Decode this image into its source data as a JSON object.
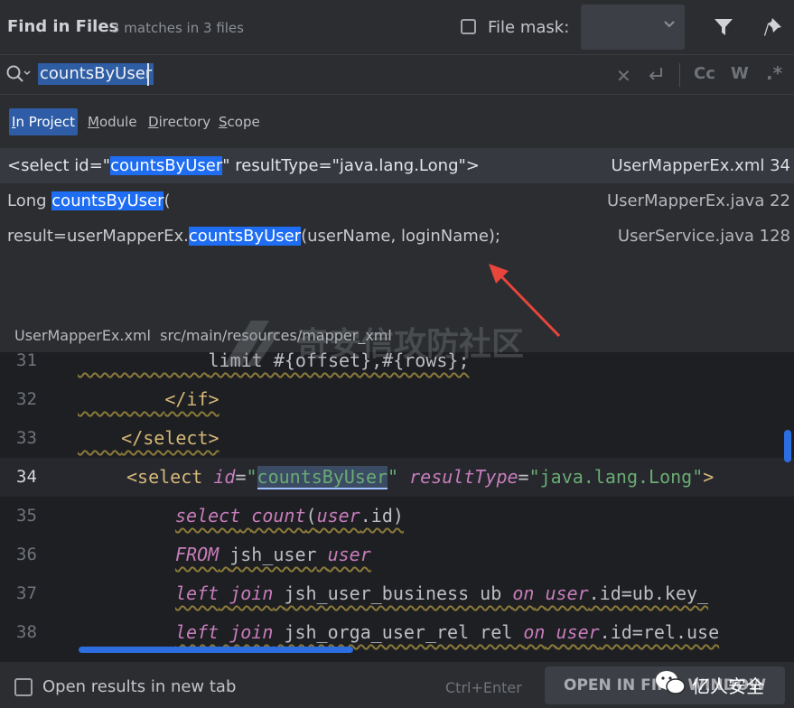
{
  "header": {
    "title": "Find in Files",
    "match_summary": "3 matches in 3 files",
    "file_mask_label": "File mask:"
  },
  "search": {
    "query": "countsByUser",
    "case_icon_label": "Cc",
    "words_icon_label": "W",
    "regex_icon_label": ".*"
  },
  "scope_tabs": [
    {
      "label": "In Project",
      "active": true
    },
    {
      "label": "Module",
      "active": false
    },
    {
      "label": "Directory",
      "active": false
    },
    {
      "label": "Scope",
      "active": false
    }
  ],
  "results": [
    {
      "before": "<select id=\"",
      "match": "countsByUser",
      "after": "\" resultType=\"java.lang.Long\">",
      "file": "UserMapperEx.xml 34",
      "selected": true
    },
    {
      "before": "Long ",
      "match": "countsByUser",
      "after": "(",
      "file": "UserMapperEx.java 22",
      "selected": false
    },
    {
      "before": "result=userMapperEx.",
      "match": "countsByUser",
      "after": "(userName, loginName);",
      "file": "UserService.java 128",
      "selected": false
    }
  ],
  "preview": {
    "file_name": "UserMapperEx.xml",
    "file_path": "src/main/resources/mapper_xml",
    "current_line": 34,
    "lines": [
      {
        "num": "31",
        "text": "limit #{offset},#{rows};"
      },
      {
        "num": "32",
        "text": "</if>"
      },
      {
        "num": "33",
        "text": "</select>"
      },
      {
        "num": "34",
        "text": "<select id=\"countsByUser\" resultType=\"java.lang.Long\">"
      },
      {
        "num": "35",
        "text": "select count(user.id)"
      },
      {
        "num": "36",
        "text": "FROM jsh_user user"
      },
      {
        "num": "37",
        "text": "left join jsh_user_business ub on user.id=ub.key_"
      },
      {
        "num": "38",
        "text": "left join jsh_orga_user_rel rel on user.id=rel.use"
      }
    ]
  },
  "footer": {
    "open_new_tab_label": "Open results in new tab",
    "shortcut": "Ctrl+Enter",
    "open_button": "OPEN IN FIND WINDOW"
  },
  "watermark": {
    "text": "奇安信攻防社区"
  },
  "brand": {
    "text": "亿人安全"
  },
  "colors": {
    "accent": "#2e5ca6",
    "match_highlight": "#1e6df2",
    "annotation_arrow": "#e8453c",
    "editor_bg": "#1e1f22",
    "panel_bg": "#2b2d30"
  }
}
